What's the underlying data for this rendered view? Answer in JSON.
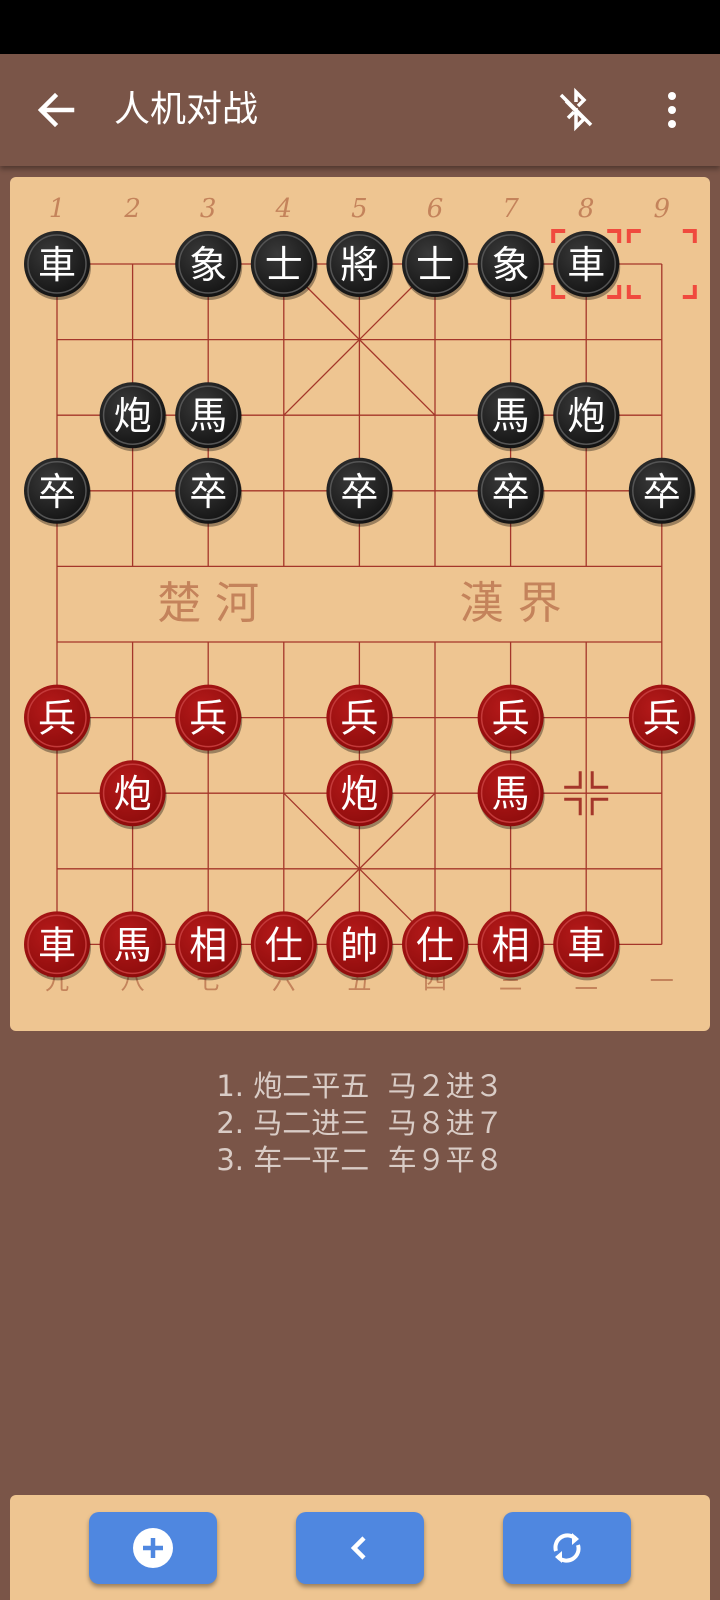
{
  "app_bar": {
    "title": "人机对战",
    "back_icon": "arrow-back-icon",
    "bluetooth_icon": "bluetooth-disabled-icon",
    "menu_icon": "more-vert-icon"
  },
  "board": {
    "top_numbers": [
      "1",
      "2",
      "3",
      "4",
      "5",
      "6",
      "7",
      "8",
      "9"
    ],
    "bottom_numbers": [
      "九",
      "八",
      "七",
      "六",
      "五",
      "四",
      "三",
      "二",
      "一"
    ],
    "river_left": "楚 河",
    "river_right": "漢 界",
    "pieces": [
      {
        "side": "black",
        "char": "車",
        "file": 0,
        "rank": 0
      },
      {
        "side": "black",
        "char": "象",
        "file": 2,
        "rank": 0
      },
      {
        "side": "black",
        "char": "士",
        "file": 3,
        "rank": 0
      },
      {
        "side": "black",
        "char": "將",
        "file": 4,
        "rank": 0
      },
      {
        "side": "black",
        "char": "士",
        "file": 5,
        "rank": 0
      },
      {
        "side": "black",
        "char": "象",
        "file": 6,
        "rank": 0
      },
      {
        "side": "black",
        "char": "車",
        "file": 7,
        "rank": 0
      },
      {
        "side": "black",
        "char": "炮",
        "file": 1,
        "rank": 2
      },
      {
        "side": "black",
        "char": "馬",
        "file": 2,
        "rank": 2
      },
      {
        "side": "black",
        "char": "馬",
        "file": 6,
        "rank": 2
      },
      {
        "side": "black",
        "char": "炮",
        "file": 7,
        "rank": 2
      },
      {
        "side": "black",
        "char": "卒",
        "file": 0,
        "rank": 3
      },
      {
        "side": "black",
        "char": "卒",
        "file": 2,
        "rank": 3
      },
      {
        "side": "black",
        "char": "卒",
        "file": 4,
        "rank": 3
      },
      {
        "side": "black",
        "char": "卒",
        "file": 6,
        "rank": 3
      },
      {
        "side": "black",
        "char": "卒",
        "file": 8,
        "rank": 3
      },
      {
        "side": "red",
        "char": "兵",
        "file": 0,
        "rank": 6
      },
      {
        "side": "red",
        "char": "兵",
        "file": 2,
        "rank": 6
      },
      {
        "side": "red",
        "char": "兵",
        "file": 4,
        "rank": 6
      },
      {
        "side": "red",
        "char": "兵",
        "file": 6,
        "rank": 6
      },
      {
        "side": "red",
        "char": "兵",
        "file": 8,
        "rank": 6
      },
      {
        "side": "red",
        "char": "炮",
        "file": 1,
        "rank": 7
      },
      {
        "side": "red",
        "char": "炮",
        "file": 4,
        "rank": 7
      },
      {
        "side": "red",
        "char": "馬",
        "file": 6,
        "rank": 7
      },
      {
        "side": "red",
        "char": "車",
        "file": 0,
        "rank": 9
      },
      {
        "side": "red",
        "char": "馬",
        "file": 1,
        "rank": 9
      },
      {
        "side": "red",
        "char": "相",
        "file": 2,
        "rank": 9
      },
      {
        "side": "red",
        "char": "仕",
        "file": 3,
        "rank": 9
      },
      {
        "side": "red",
        "char": "帥",
        "file": 4,
        "rank": 9
      },
      {
        "side": "red",
        "char": "仕",
        "file": 5,
        "rank": 9
      },
      {
        "side": "red",
        "char": "相",
        "file": 6,
        "rank": 9
      },
      {
        "side": "red",
        "char": "車",
        "file": 7,
        "rank": 9
      }
    ],
    "last_move_from": {
      "file": 8,
      "rank": 0
    },
    "last_move_to": {
      "file": 7,
      "rank": 0
    },
    "empty_point_marker": {
      "file": 7,
      "rank": 7
    },
    "colors": {
      "board_bg": "#eec591",
      "grid_line": "#a4362a",
      "black_piece": "#111111",
      "red_piece": "#8c0b0b",
      "piece_text": "#ffffff",
      "selection": "#f04a3e"
    }
  },
  "moves": [
    "1. 炮二平五  马２进３",
    "2. 马二进三  马８进７",
    "3. 车一平二  车９平８"
  ],
  "bottom_bar": {
    "buttons": [
      {
        "name": "new-game-button",
        "icon": "add-circle-icon"
      },
      {
        "name": "undo-button",
        "icon": "chevron-left-icon"
      },
      {
        "name": "flip-board-button",
        "icon": "sync-icon"
      }
    ]
  }
}
